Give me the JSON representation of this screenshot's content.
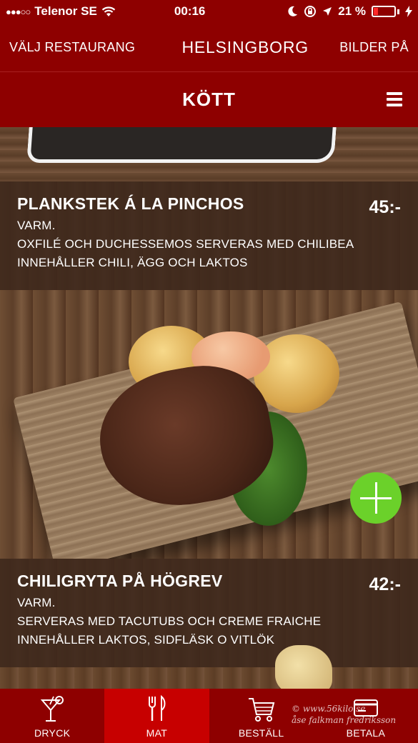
{
  "status_bar": {
    "signal_dots": "●●●○○",
    "carrier": "Telenor SE",
    "time": "00:16",
    "battery_percent": "21 %",
    "battery_level": 0.21,
    "icons": [
      "wifi-icon",
      "moon-icon",
      "rotation-lock-icon",
      "location-arrow-icon",
      "battery-icon",
      "charging-bolt-icon"
    ]
  },
  "nav": {
    "left_label": "VÄLJ RESTAURANG",
    "title": "HELSINGBORG",
    "right_label": "BILDER PÅ"
  },
  "category": {
    "title": "KÖTT",
    "menu_icon": "hamburger-menu-icon"
  },
  "items": [
    {
      "name": "PLANKSTEK Á LA PINCHOS",
      "price": "45:-",
      "lines": [
        "VARM.",
        "OXFILÉ OCH DUCHESSEMOS SERVERAS MED CHILIBEA",
        "INNEHÅLLER CHILI, ÄGG OCH LAKTOS"
      ]
    },
    {
      "name": "CHILIGRYTA PÅ HÖGREV",
      "price": "42:-",
      "lines": [
        "VARM.",
        "SERVERAS MED TACUTUBS OCH CREME FRAICHE",
        "INNEHÅLLER LAKTOS, SIDFLÄSK O VITLÖK"
      ]
    }
  ],
  "add_button_icon": "plus-icon",
  "colors": {
    "brand_red": "#8e0000",
    "active_tab": "#c70000",
    "add_green": "#6bd12a"
  },
  "tabs": [
    {
      "label": "DRYCK",
      "icon": "cocktail-glass-icon",
      "active": false
    },
    {
      "label": "MAT",
      "icon": "fork-knife-icon",
      "active": true
    },
    {
      "label": "BESTÄLL",
      "icon": "shopping-cart-icon",
      "active": false
    },
    {
      "label": "BETALA",
      "icon": "credit-card-icon",
      "active": false
    }
  ],
  "watermark": {
    "line1": "© www.56kilo.se",
    "line2": "åse falkman fredriksson"
  }
}
